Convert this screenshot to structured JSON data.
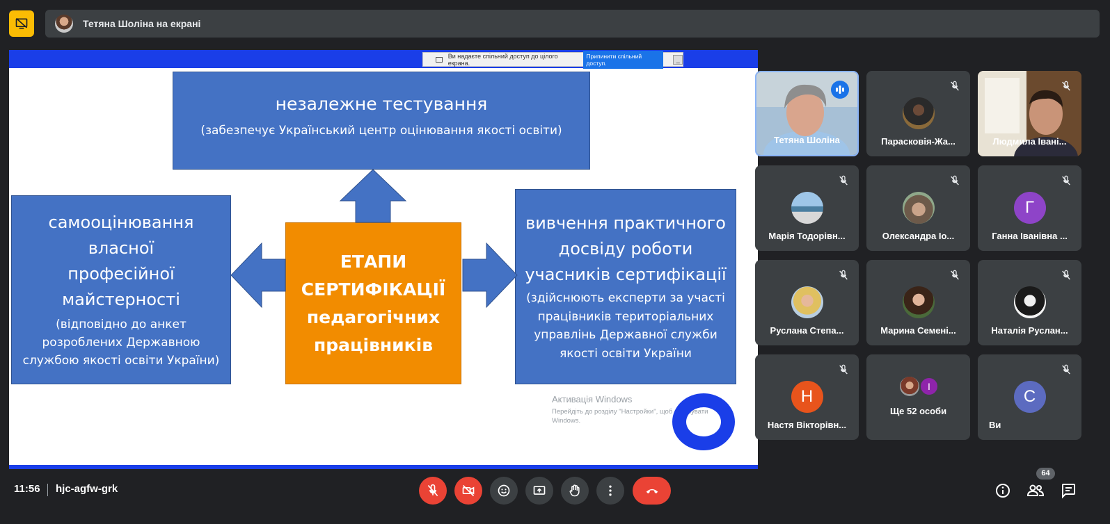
{
  "banner": {
    "presenter_text": "Тетяна Шоліна на екрані"
  },
  "share_strip": {
    "message": "Ви надаєте спільний доступ до цілого екрана.",
    "stop_label": "Припинити спільний доступ.",
    "minimize_label": "_"
  },
  "slide": {
    "top_title": "незалежне тестування",
    "top_subtitle": "(забезпечує Український центр оцінювання якості освіти)",
    "left_title_lines": [
      "самооцінювання",
      "власної",
      "професійної",
      "майстерності"
    ],
    "left_subtitle_lines": [
      "(відповідно до анкет",
      "розроблених Державною",
      "службою якості освіти України)"
    ],
    "center_lines": [
      "ЕТАПИ",
      "СЕРТИФІКАЦІЇ",
      "педагогічних",
      "працівників"
    ],
    "right_title_lines": [
      "вивчення практичного",
      "досвіду роботи",
      "учасників сертифікації"
    ],
    "right_subtitle_lines": [
      "(здійснюють експерти за участі",
      "працівників територіальних",
      "управлінь Державної служби",
      "якості освіти України"
    ],
    "colors": {
      "box_blue": "#4472c4",
      "center_orange": "#f28c00",
      "bar_blue": "#1a3ee8"
    }
  },
  "watermark": {
    "title": "Активація Windows",
    "text": "Перейдіть до розділу \"Настройки\", щоб активувати Windows."
  },
  "participants": [
    {
      "name": "Тетяна Шоліна",
      "type": "video",
      "speaking": true
    },
    {
      "name": "Парасковія-Жа...",
      "type": "photo",
      "muted": true
    },
    {
      "name": "Людмила Івані...",
      "type": "video",
      "muted": true
    },
    {
      "name": "Марія Тодорівн...",
      "type": "photo",
      "muted": true
    },
    {
      "name": "Олександра Іо...",
      "type": "photo",
      "muted": true
    },
    {
      "name": "Ганна Іванівна ...",
      "type": "letter",
      "letter": "Г",
      "color": "#8e44c8",
      "muted": true
    },
    {
      "name": "Руслана Степа...",
      "type": "photo",
      "muted": true
    },
    {
      "name": "Марина Семені...",
      "type": "photo",
      "muted": true
    },
    {
      "name": "Наталія Руслан...",
      "type": "photo",
      "muted": true
    },
    {
      "name": "Настя Вікторівн...",
      "type": "letter",
      "letter": "Н",
      "color": "#e8541c",
      "muted": true
    },
    {
      "name": "Ще 52 особи",
      "type": "group",
      "letter": "І"
    },
    {
      "name": "Ви",
      "type": "letter",
      "letter": "С",
      "color": "#5c6bc0",
      "muted": true
    }
  ],
  "bottom": {
    "time": "11:56",
    "meeting_code": "hjc-agfw-grk",
    "people_count": "64"
  },
  "icons": [
    "present-off-icon",
    "mic-off-icon",
    "camera-off-icon",
    "emoji-icon",
    "present-screen-icon",
    "raise-hand-icon",
    "more-icon",
    "hang-up-icon",
    "info-icon",
    "people-icon",
    "chat-icon",
    "speaking-icon"
  ]
}
